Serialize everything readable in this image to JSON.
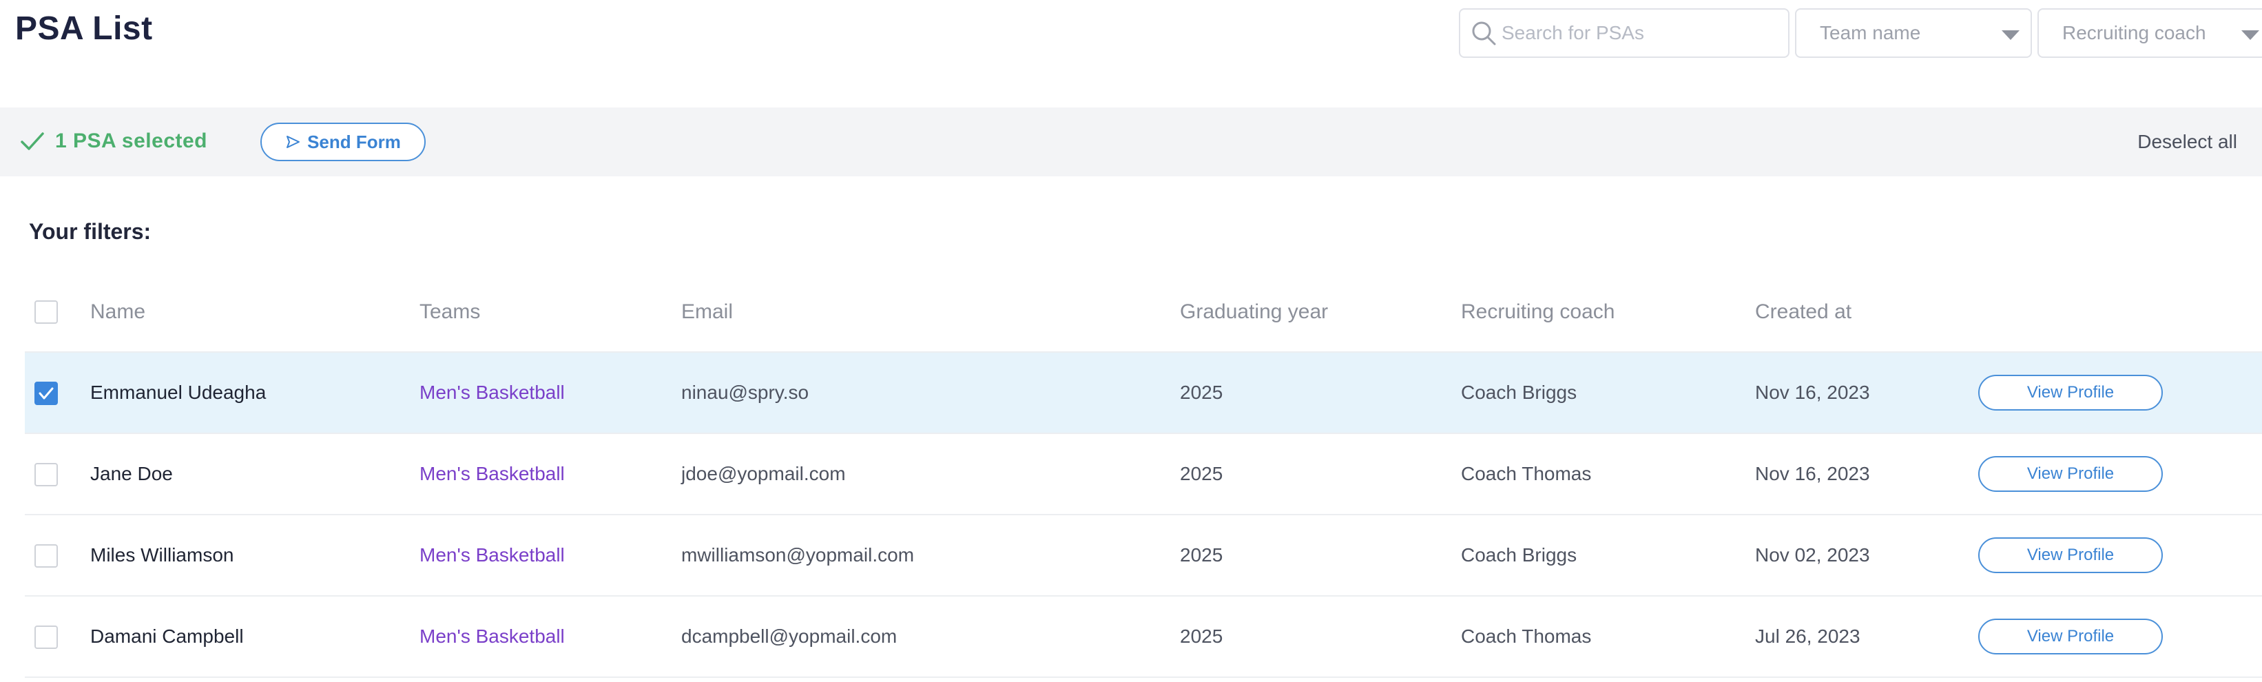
{
  "page": {
    "title": "PSA List"
  },
  "search": {
    "placeholder": "Search for PSAs",
    "icon": "search-icon"
  },
  "filters_dropdowns": {
    "team": {
      "value": "Team name",
      "icon": "chevron-down-icon"
    },
    "coach": {
      "value": "Recruiting coach",
      "icon": "chevron-down-icon"
    }
  },
  "selection_bar": {
    "status_text": "1 PSA selected",
    "status_icon": "checkmark-icon",
    "send_form_label": "Send Form",
    "send_form_icon": "send-icon",
    "deselect_label": "Deselect all",
    "status_color": "#4caf6e",
    "accent_color": "#3a83d3"
  },
  "filters_label": "Your filters:",
  "table": {
    "columns": [
      "Name",
      "Teams",
      "Email",
      "Graduating year",
      "Recruiting coach",
      "Created at"
    ],
    "view_profile_label": "View Profile",
    "rows": [
      {
        "selected": true,
        "name": "Emmanuel  Udeagha",
        "team": "Men's Basketball",
        "email": "ninau@spry.so",
        "year": "2025",
        "coach": "Coach Briggs",
        "created": "Nov 16, 2023"
      },
      {
        "selected": false,
        "name": "Jane Doe",
        "team": "Men's Basketball",
        "email": "jdoe@yopmail.com",
        "year": "2025",
        "coach": "Coach Thomas",
        "created": "Nov 16, 2023"
      },
      {
        "selected": false,
        "name": "Miles Williamson",
        "team": "Men's Basketball",
        "email": "mwilliamson@yopmail.com",
        "year": "2025",
        "coach": "Coach Briggs",
        "created": "Nov 02, 2023"
      },
      {
        "selected": false,
        "name": "Damani Campbell",
        "team": "Men's Basketball",
        "email": "dcampbell@yopmail.com",
        "year": "2025",
        "coach": "Coach Thomas",
        "created": "Jul 26, 2023"
      }
    ]
  }
}
